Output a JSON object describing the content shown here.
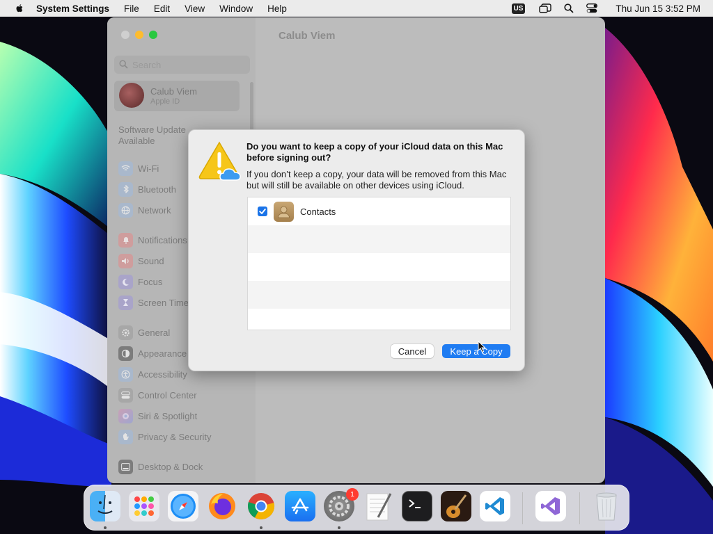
{
  "menubar": {
    "app_name": "System Settings",
    "menus": [
      "File",
      "Edit",
      "View",
      "Window",
      "Help"
    ],
    "input_badge": "US",
    "clock": "Thu Jun 15  3:52 PM"
  },
  "window": {
    "title": "Calub Viem",
    "search_placeholder": "Search",
    "account": {
      "name": "Calub Viem",
      "subtitle": "Apple ID"
    },
    "software_update": "Software Update\nAvailable",
    "sidebar_items": [
      {
        "label": "Wi-Fi",
        "icon": "wifi-icon",
        "color": "#a9b8cc"
      },
      {
        "label": "Bluetooth",
        "icon": "bluetooth-icon",
        "color": "#a9b8cc"
      },
      {
        "label": "Network",
        "icon": "globe-icon",
        "color": "#a9b8cc"
      },
      {
        "label": "Notifications",
        "icon": "bell-icon",
        "color": "#cf9d9d"
      },
      {
        "label": "Sound",
        "icon": "speaker-icon",
        "color": "#cf9d9d"
      },
      {
        "label": "Focus",
        "icon": "moon-icon",
        "color": "#a9a4c9"
      },
      {
        "label": "Screen Time",
        "icon": "hourglass-icon",
        "color": "#a9a4c9"
      },
      {
        "label": "General",
        "icon": "gear-icon",
        "color": "#a7a7a7"
      },
      {
        "label": "Appearance",
        "icon": "appearance-icon",
        "color": "#7c7c7c"
      },
      {
        "label": "Accessibility",
        "icon": "accessibility-icon",
        "color": "#a9b8cc"
      },
      {
        "label": "Control Center",
        "icon": "control-center-icon",
        "color": "#a7a7a7"
      },
      {
        "label": "Siri & Spotlight",
        "icon": "siri-icon",
        "color": "#b3a0c4"
      },
      {
        "label": "Privacy & Security",
        "icon": "hand-icon",
        "color": "#a9b8cc"
      },
      {
        "label": "Desktop & Dock",
        "icon": "dock-icon",
        "color": "#7c7c7c"
      }
    ]
  },
  "dialog": {
    "title": "Do you want to keep a copy of your iCloud data on this Mac before signing out?",
    "message": "If you don’t keep a copy, your data will be removed from this Mac but will still be available on other devices using iCloud.",
    "items": [
      {
        "label": "Contacts",
        "checked": true,
        "icon": "contacts-icon"
      }
    ],
    "cancel_label": "Cancel",
    "keep_label": "Keep a Copy"
  },
  "dock": {
    "apps": [
      "finder-icon",
      "launchpad-icon",
      "safari-icon",
      "firefox-icon",
      "chrome-icon",
      "app-store-icon",
      "system-settings-icon",
      "textedit-icon",
      "terminal-icon",
      "garageband-icon",
      "vscode-icon",
      "visual-studio-icon",
      "trash-icon"
    ],
    "settings_badge": "1"
  },
  "colors": {
    "accent": "#1f7cf2",
    "badge": "#ff3b30"
  }
}
